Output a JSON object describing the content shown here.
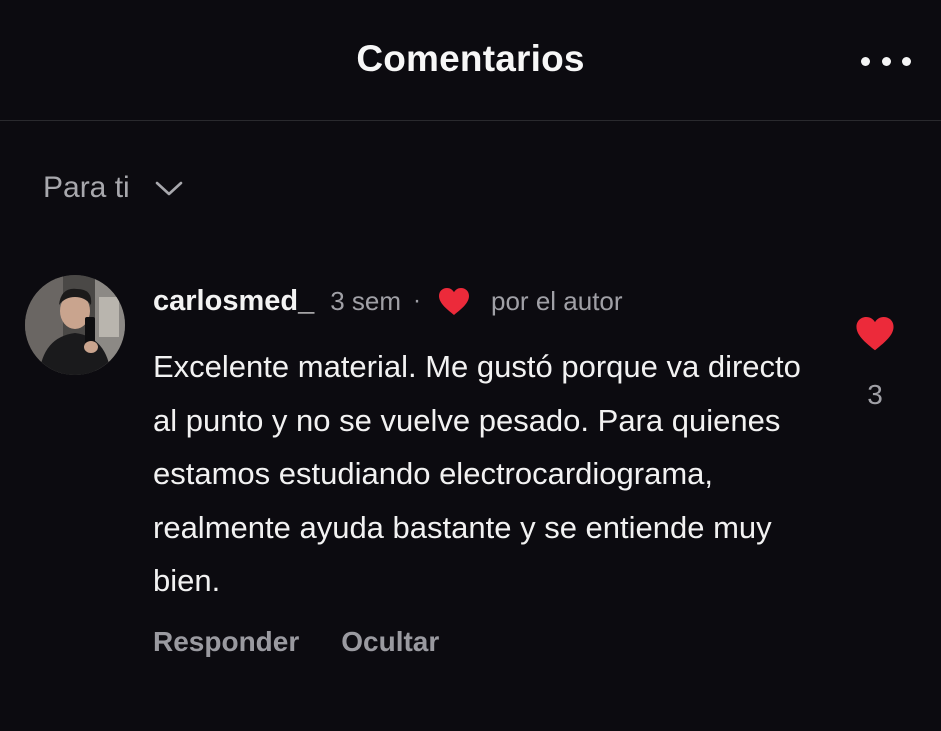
{
  "header": {
    "title": "Comentarios",
    "more_icon": "more-horizontal-icon"
  },
  "sort": {
    "label": "Para ti",
    "icon": "chevron-down-icon"
  },
  "comment": {
    "username": "carlosmed_",
    "time": "3 sem",
    "separator": "·",
    "author_like_label": "por el autor",
    "text": "Excelente material. Me gustó porque va directo al punto y no se vuelve pesado. Para quienes estamos estudiando electrocardiograma, realmente ayuda bastante y se entiende muy bien.",
    "like_count": "3",
    "actions": {
      "reply": "Responder",
      "hide": "Ocultar"
    }
  },
  "colors": {
    "background": "#0c0b10",
    "heart": "#ec2a3a",
    "muted_text": "#a0a0a6"
  }
}
